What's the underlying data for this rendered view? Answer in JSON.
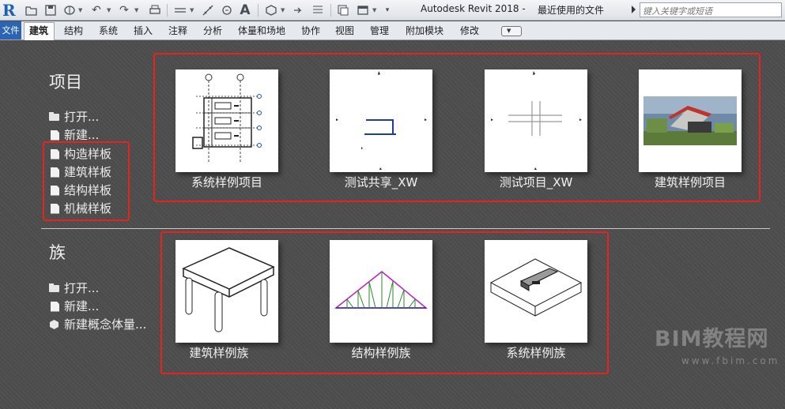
{
  "app": {
    "title": "Autodesk Revit 2018 -",
    "document": "最近使用的文件",
    "search_placeholder": "键入关键字或短语"
  },
  "ribbon": {
    "file_tab": "文件",
    "tabs": [
      "建筑",
      "结构",
      "系统",
      "插入",
      "注释",
      "分析",
      "体量和场地",
      "协作",
      "视图",
      "管理",
      "附加模块",
      "修改"
    ],
    "active_tab": "建筑"
  },
  "projects": {
    "heading": "项目",
    "links": [
      "打开...",
      "新建...",
      "构造样板",
      "建筑样板",
      "结构样板",
      "机械样板"
    ],
    "recent": [
      "系统样例项目",
      "测试共享_XW",
      "测试项目_XW",
      "建筑样例项目"
    ]
  },
  "families": {
    "heading": "族",
    "links": [
      "打开...",
      "新建...",
      "新建概念体量..."
    ],
    "recent": [
      "建筑样例族",
      "结构样例族",
      "系统样例族"
    ]
  },
  "watermark": {
    "text": "BIM教程网",
    "url": "www.fbim.com"
  },
  "colors": {
    "highlight": "#e8231e",
    "file_tab": "#2a64b3",
    "background": "#4c4c4c"
  }
}
